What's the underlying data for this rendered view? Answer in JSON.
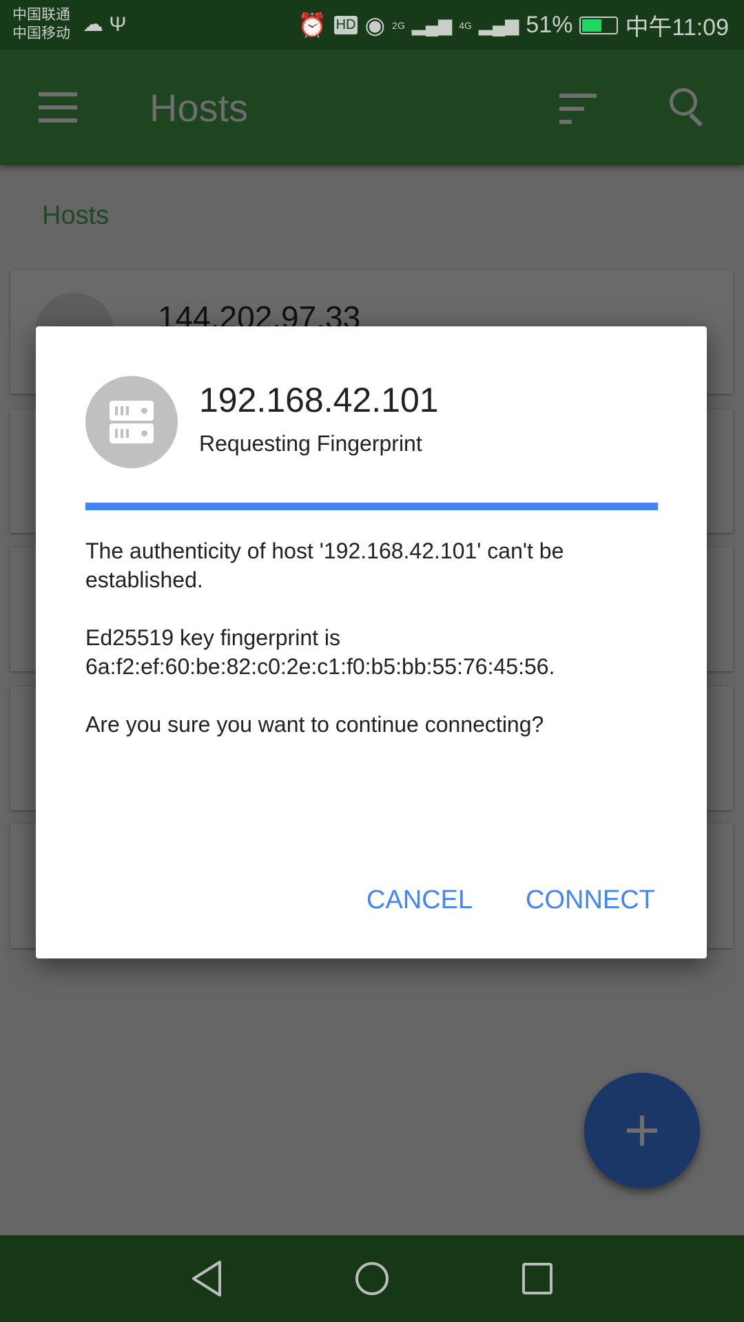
{
  "status_bar": {
    "carrier_1": "中国联通",
    "carrier_2": "中国移动",
    "signal_2g": "2G",
    "signal_4g": "4G",
    "battery": "51%",
    "time": "中午11:09",
    "icons": [
      "cloud-icon",
      "usb-icon",
      "alarm-icon",
      "hd-icon",
      "eye-icon",
      "signal-icon",
      "battery-charging-icon"
    ]
  },
  "app_bar": {
    "title": "Hosts",
    "icons": [
      "menu-icon",
      "sort-icon",
      "search-icon"
    ]
  },
  "section_header": "Hosts",
  "hosts": [
    {
      "name": "144.202.97.33",
      "icon": "linux-icon"
    },
    {
      "name": ""
    },
    {
      "name": ""
    },
    {
      "name": ""
    },
    {
      "name": ""
    }
  ],
  "dialog": {
    "host": "192.168.42.101",
    "subtitle": "Requesting Fingerprint",
    "icon": "server-icon",
    "progress": "indeterminate",
    "message_1": "The authenticity of host '192.168.42.101' can't be established.",
    "message_2": "Ed25519 key fingerprint is 6a:f2:ef:60:be:82:c0:2e:c1:f0:b5:bb:55:76:45:56.",
    "message_3": "Are you sure you want to continue connecting?",
    "cancel": "CANCEL",
    "connect": "CONNECT"
  },
  "colors": {
    "accent": "#4285f4",
    "app_bar": "#4caf50",
    "fab": "#3366cc"
  }
}
